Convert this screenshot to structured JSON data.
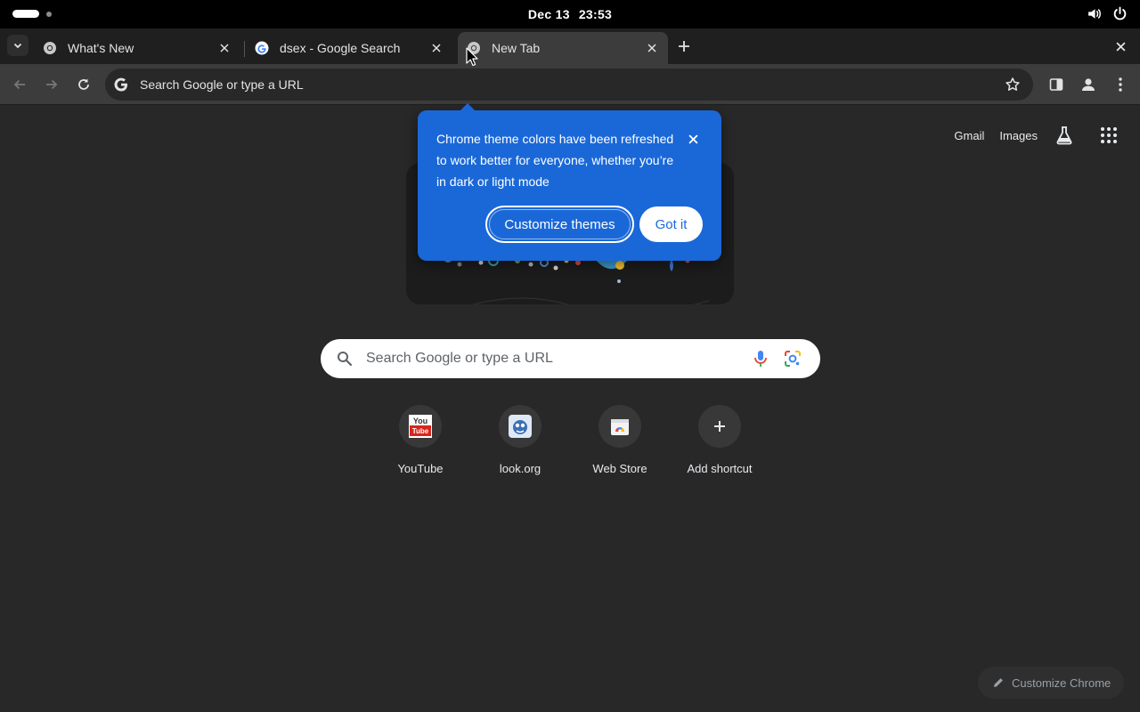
{
  "system_bar": {
    "date": "Dec 13",
    "time": "23:53",
    "icons": [
      "volume-icon",
      "power-icon"
    ]
  },
  "tabs": [
    {
      "title": "What's New",
      "icon": "chrome-icon",
      "active": false
    },
    {
      "title": "dsex - Google Search",
      "icon": "google-icon",
      "active": false
    },
    {
      "title": "New Tab",
      "icon": "chrome-icon",
      "active": true
    }
  ],
  "omnibox": {
    "placeholder": "Search Google or type a URL"
  },
  "ntp": {
    "header_links": [
      "Gmail",
      "Images"
    ],
    "search_placeholder": "Search Google or type a URL",
    "shortcuts": [
      {
        "label": "YouTube",
        "icon": "youtube-icon"
      },
      {
        "label": "look.org",
        "icon": "look-icon"
      },
      {
        "label": "Web Store",
        "icon": "web-store-icon"
      },
      {
        "label": "Add shortcut",
        "icon": "plus-icon"
      }
    ],
    "customize_chrome": "Customize Chrome"
  },
  "promo": {
    "message": "Chrome theme colors have been refreshed to work better for everyone, whether you’re in dark or light mode",
    "customize_label": "Customize themes",
    "dismiss_label": "Got it"
  },
  "colors": {
    "promo_bg": "#1a68d8",
    "page_bg": "#282828",
    "toolbar_bg": "#3c3c3c",
    "tabstrip_bg": "#1f1f1f"
  }
}
